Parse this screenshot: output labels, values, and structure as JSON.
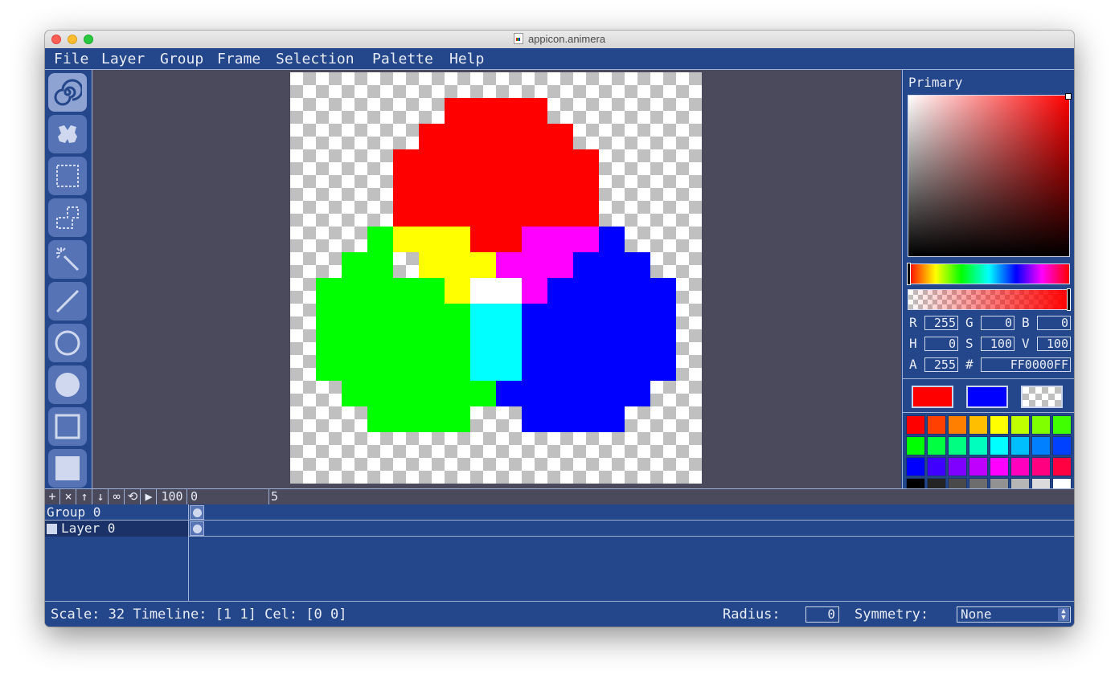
{
  "window": {
    "title": "appicon.animera"
  },
  "menu": [
    "File",
    "Layer",
    "Group",
    "Frame",
    "Selection",
    "Palette",
    "Help"
  ],
  "tools": [
    {
      "icon": "brush-spiral-icon",
      "active": true
    },
    {
      "icon": "flood-fill-icon",
      "active": false
    },
    {
      "icon": "rect-select-icon",
      "active": false
    },
    {
      "icon": "polygon-select-icon",
      "active": false
    },
    {
      "icon": "magic-wand-icon",
      "active": false
    },
    {
      "icon": "line-icon",
      "active": false
    },
    {
      "icon": "circle-outline-icon",
      "active": false
    },
    {
      "icon": "circle-filled-icon",
      "active": false
    },
    {
      "icon": "rect-outline-icon",
      "active": false
    },
    {
      "icon": "rect-filled-icon",
      "active": false
    }
  ],
  "colors": {
    "red": "#ff0000",
    "green": "#00ff00",
    "blue": "#0000ff",
    "yellow": "#ffff00",
    "magenta": "#ff00ff",
    "cyan": "#00ffff",
    "white": "#ffffff"
  },
  "color_picker": {
    "label": "Primary",
    "fields": {
      "r_label": "R",
      "r": "255",
      "g_label": "G",
      "g": "0",
      "b_label": "B",
      "b": "0",
      "h_label": "H",
      "h": "0",
      "s_label": "S",
      "s": "100",
      "v_label": "V",
      "v": "100",
      "a_label": "A",
      "a": "255",
      "hex_label": "#",
      "hex": "FF0000FF"
    },
    "swatches": {
      "primary": "#ff0000",
      "secondary": "#0000ff",
      "erase": "transparent"
    }
  },
  "palette": [
    "#ff0000",
    "#ff4000",
    "#ff8000",
    "#ffbf00",
    "#ffff00",
    "#bfff00",
    "#80ff00",
    "#40ff00",
    "#00ff00",
    "#00ff40",
    "#00ff80",
    "#00ffbf",
    "#00ffff",
    "#00bfff",
    "#0080ff",
    "#0040ff",
    "#0000ff",
    "#4000ff",
    "#8000ff",
    "#bf00ff",
    "#ff00ff",
    "#ff00bf",
    "#ff0080",
    "#ff0040",
    "#000000",
    "#242424",
    "#494949",
    "#6d6d6d",
    "#929292",
    "#b6b6b6",
    "#dbdbdb",
    "#ffffff"
  ],
  "timeline": {
    "controls": [
      "+",
      "×",
      "↑",
      "↓",
      "∞",
      "⟲",
      "▶"
    ],
    "speed": "100",
    "frame_labels": [
      "0",
      "5"
    ]
  },
  "layers": {
    "group_name": "Group 0",
    "layer_name": "Layer 0"
  },
  "status": {
    "info": "Scale: 32 Timeline: [1 1] Cel: [0 0]",
    "radius_label": "Radius:",
    "radius_value": "0",
    "symmetry_label": "Symmetry:",
    "symmetry_value": "None"
  }
}
